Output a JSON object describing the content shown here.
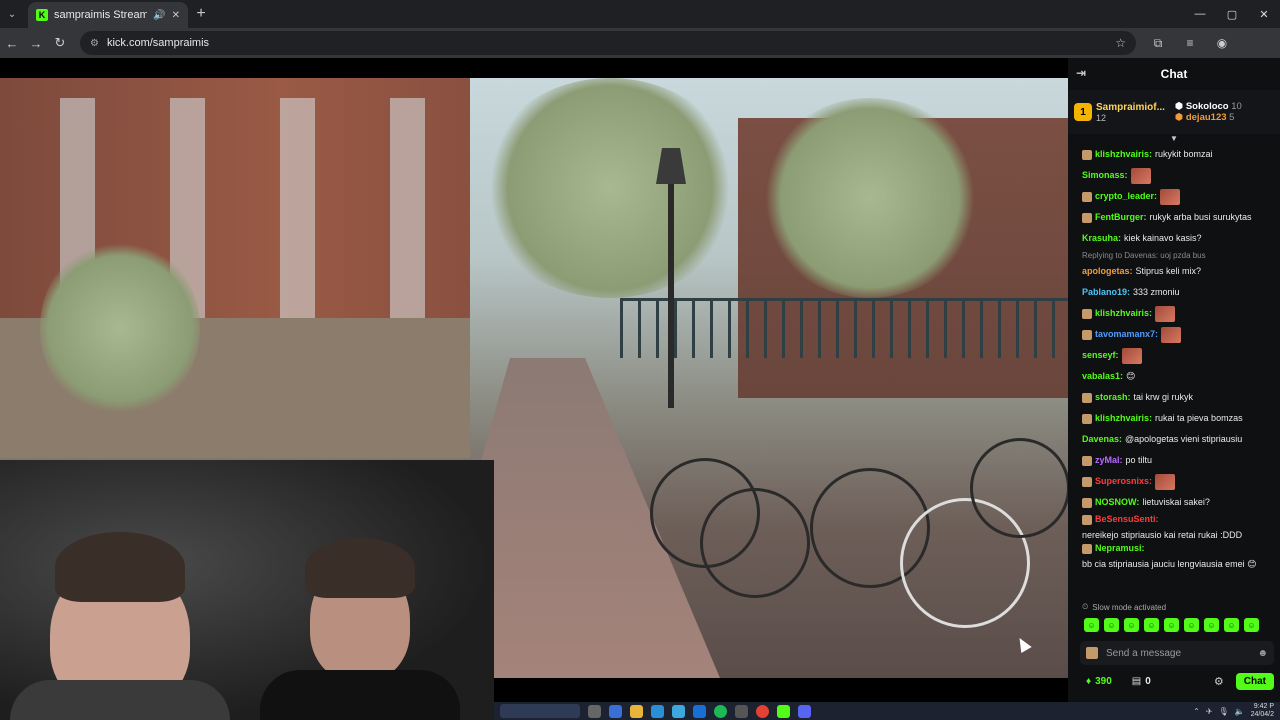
{
  "browser": {
    "tab_title": "sampraimis Stream - Watch",
    "favicon_letter": "K",
    "url": "kick.com/sampraimis"
  },
  "chat": {
    "title": "Chat",
    "top_supporter": {
      "name": "Sampraimiof...",
      "count": "12"
    },
    "side_supporters": [
      {
        "name": "Sokoloco",
        "count": "10"
      },
      {
        "name": "dejau123",
        "count": "5"
      }
    ],
    "messages": [
      {
        "user": "klishzhvairis:",
        "text": "rukykit bomzai",
        "color": "#53fc18",
        "badge": true,
        "emote": false
      },
      {
        "user": "Simonass:",
        "text": "",
        "color": "#53fc18",
        "badge": false,
        "emote": true
      },
      {
        "user": "crypto_leader:",
        "text": "",
        "color": "#53fc18",
        "badge": true,
        "emote": true
      },
      {
        "user": "FentBurger:",
        "text": "rukyk arba busi surukytas",
        "color": "#53fc18",
        "badge": true,
        "emote": false
      },
      {
        "user": "Krasuha:",
        "text": "kiek kainavo kasis?",
        "color": "#53fc18",
        "badge": false,
        "emote": false
      },
      {
        "reply": "Replying to Davenas: uoj pzda bus"
      },
      {
        "user": "apologetas:",
        "text": "Stiprus keli mix?",
        "color": "#f29c38",
        "badge": false,
        "emote": false
      },
      {
        "user": "Pablano19:",
        "text": "333 zmoniu",
        "color": "#4fc3f7",
        "badge": false,
        "emote": false
      },
      {
        "user": "klishzhvairis:",
        "text": "",
        "color": "#53fc18",
        "badge": true,
        "emote": true
      },
      {
        "user": "tavomamanx7:",
        "text": "",
        "color": "#4f9cff",
        "badge": true,
        "emote": true
      },
      {
        "user": "senseyf:",
        "text": "",
        "color": "#53fc18",
        "badge": false,
        "emote": true
      },
      {
        "user": "vabalas1:",
        "text": "😊",
        "color": "#53fc18",
        "badge": false,
        "emote": false
      },
      {
        "user": "storash:",
        "text": "tai krw gi rukyk",
        "color": "#53fc18",
        "badge": true,
        "emote": false
      },
      {
        "user": "klishzhvairis:",
        "text": "rukai ta pieva bomzas",
        "color": "#53fc18",
        "badge": true,
        "emote": false
      },
      {
        "user": "Davenas:",
        "text": "@apologetas vieni stipriausiu",
        "color": "#53fc18",
        "badge": false,
        "emote": false
      },
      {
        "user": "zyMal:",
        "text": "po tiltu",
        "color": "#b86cff",
        "badge": true,
        "emote": false
      },
      {
        "user": "Superosnixs:",
        "text": "",
        "color": "#ff3b3b",
        "badge": true,
        "emote": true
      },
      {
        "user": "NOSNOW:",
        "text": "lietuviskai sakei?",
        "color": "#53fc18",
        "badge": true,
        "emote": false
      },
      {
        "user": "BeSensuSenti:",
        "text": "nereikejo stipriausio kai retai rukai :DDD",
        "color": "#ff3b3b",
        "badge": true,
        "emote": false
      },
      {
        "user": "Nepramusi:",
        "text": "bb cia stipriausia jauciu lengviausia emei 😊",
        "color": "#53fc18",
        "badge": true,
        "emote": false
      }
    ],
    "slow_mode": "Slow mode activated",
    "input_placeholder": "Send a message",
    "points": "390",
    "bag_count": "0",
    "chat_button": "Chat",
    "accent": "#53fc18"
  },
  "taskbar": {
    "time": "9:42 P",
    "date": "24/04/2"
  }
}
